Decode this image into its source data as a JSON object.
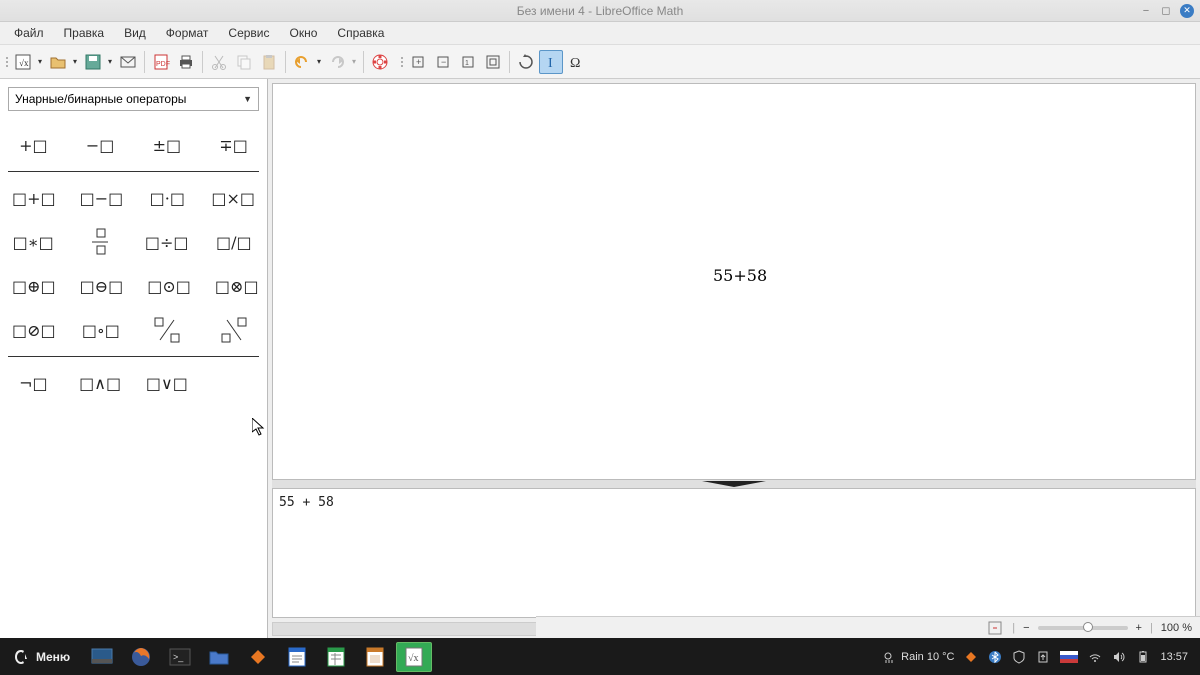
{
  "titlebar": {
    "title": "Без имени 4 - LibreOffice Math"
  },
  "menubar": {
    "items": [
      "Файл",
      "Правка",
      "Вид",
      "Формат",
      "Сервис",
      "Окно",
      "Справка"
    ]
  },
  "sidebar": {
    "category": "Унарные/бинарные операторы",
    "rows": [
      {
        "type": "row",
        "items": [
          "+□",
          "−□",
          "±□",
          "∓□"
        ]
      },
      {
        "type": "sep"
      },
      {
        "type": "row",
        "items": [
          "□+□",
          "□−□",
          "□·□",
          "□×□"
        ]
      },
      {
        "type": "row",
        "items": [
          "□∗□",
          "□/□",
          "□÷□",
          "□/□"
        ]
      },
      {
        "type": "row",
        "items": [
          "□⊕□",
          "□⊖□",
          "□⊙□",
          "□⊗□"
        ]
      },
      {
        "type": "row",
        "items": [
          "□⊘□",
          "□∘□",
          "□⁄□",
          "□\\□"
        ]
      },
      {
        "type": "sep"
      },
      {
        "type": "row",
        "items": [
          "¬□",
          "□∧□",
          "□∨□",
          ""
        ]
      }
    ]
  },
  "formula": {
    "rendered": "55+58",
    "command": "55 + 58"
  },
  "status": {
    "zoom": "100 %"
  },
  "taskbar": {
    "menu": "Меню",
    "weather": "Rain 10 °C",
    "clock": "13:57"
  }
}
